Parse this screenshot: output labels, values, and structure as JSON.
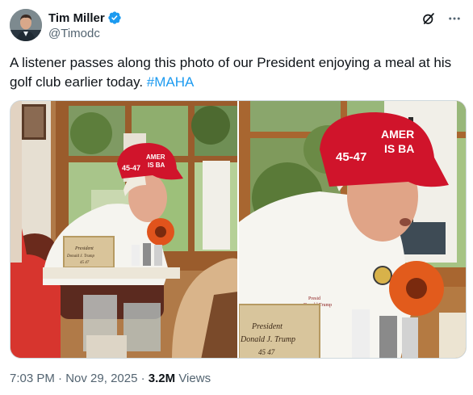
{
  "author": {
    "name": "Tim Miller",
    "handle": "@Timodc"
  },
  "icons": {
    "verified": "verified-badge-icon",
    "grok": "grok-icon",
    "more": "more-icon"
  },
  "tweet": {
    "text": "A listener passes along this photo of our  President enjoying a meal at his golf club earlier today. ",
    "hashtag": "#MAHA"
  },
  "media": {
    "left_photo": {
      "hat_text_1": "AMER",
      "hat_text_2": "IS BA",
      "hat_number": "45-47",
      "placard_line_1": "President",
      "placard_line_2": "Donald J. Trump",
      "placard_line_3": "45 47"
    },
    "right_photo": {
      "hat_text_1": "AMER",
      "hat_text_2": "IS BA",
      "hat_number": "45-47",
      "placard_line_1": "President",
      "placard_line_2": "Donald J. Trump",
      "placard_line_3": "45 47",
      "shirt_text_1": "Presid",
      "shirt_text_2": "Donald Trump"
    }
  },
  "meta": {
    "time": "7:03 PM",
    "separator": " · ",
    "date": "Nov 29, 2025",
    "views_count": "3.2M",
    "views_label": " Views"
  },
  "colors": {
    "brand_blue": "#1d9bf0",
    "secondary_text": "#536471",
    "hat_red": "#d0142b"
  }
}
